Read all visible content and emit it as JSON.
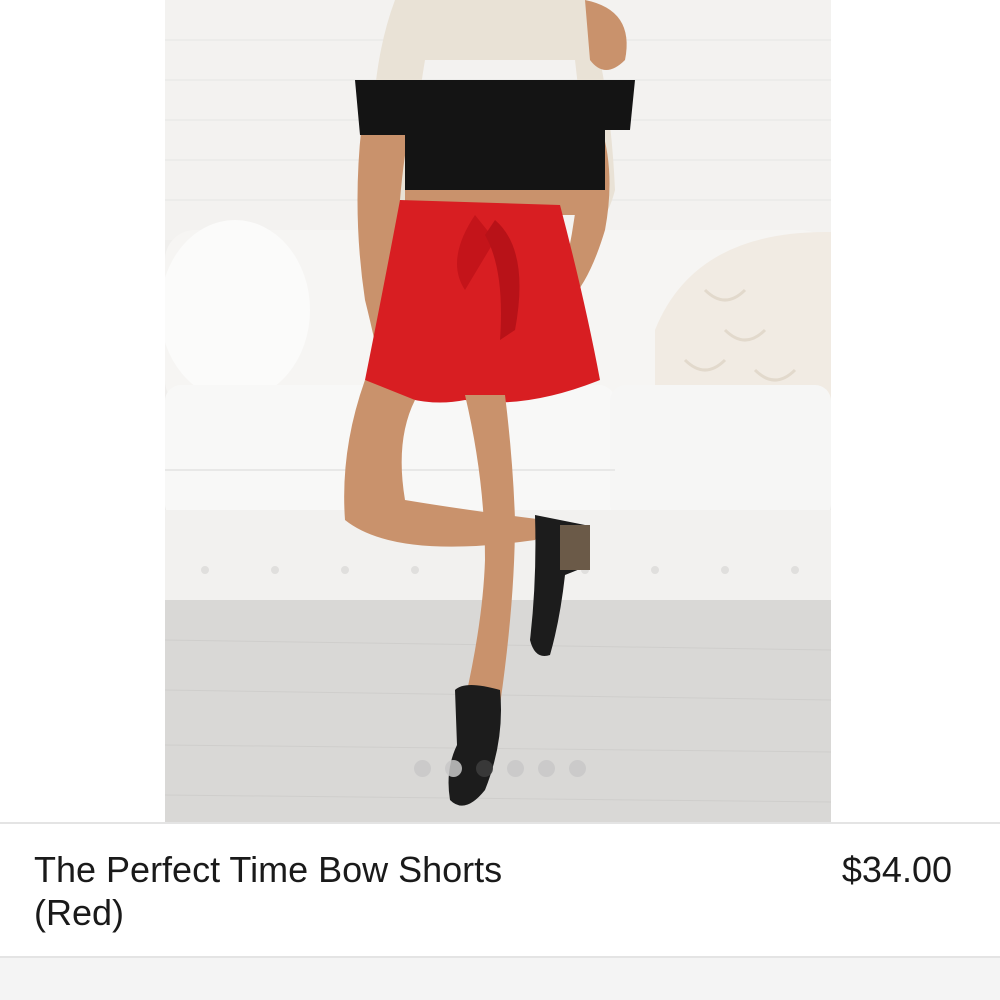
{
  "product": {
    "name": "The Perfect Time Bow Shorts (Red)",
    "price": "$34.00",
    "image_subject": "model wearing red high-waist bow shorts with black off-shoulder crop top"
  },
  "carousel": {
    "slide_count": 6,
    "active_index": 2
  },
  "colors": {
    "shorts": "#d81e22",
    "top": "#141414",
    "sofa": "#f4f3f1",
    "floor": "#d6d5d3",
    "dot_inactive": "#c8c8c8",
    "dot_active": "#3c3c3c",
    "divider": "#e4e4e4"
  }
}
